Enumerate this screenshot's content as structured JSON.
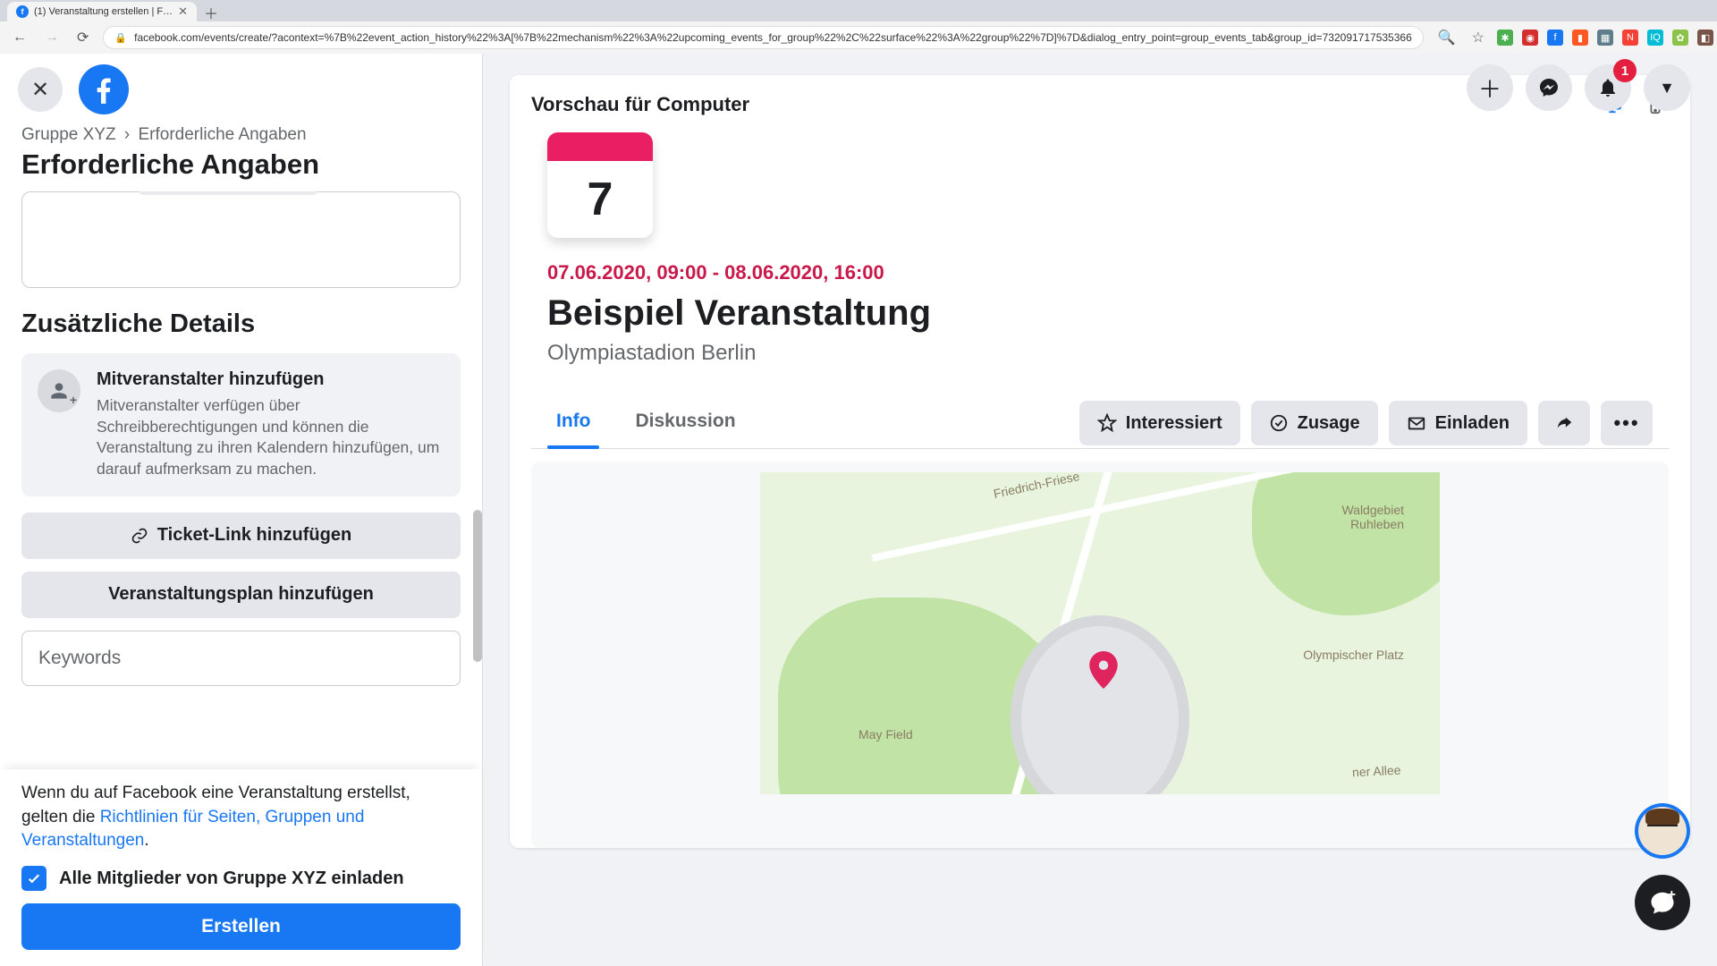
{
  "browser": {
    "tab_title": "(1) Veranstaltung erstellen | F…",
    "url": "facebook.com/events/create/?acontext=%7B%22event_action_history%22%3A[%7B%22mechanism%22%3A%22upcoming_events_for_group%22%2C%22surface%22%3A%22group%22%7D]%7D&dialog_entry_point=group_events_tab&group_id=732091717535366"
  },
  "header": {
    "notifications_count": 1
  },
  "sidebar": {
    "breadcrumb_group": "Gruppe XYZ",
    "breadcrumb_page": "Erforderliche Angaben",
    "title": "Erforderliche Angaben",
    "additional_details_title": "Zusätzliche Details",
    "coorganizers": {
      "title": "Mitveranstalter hinzufügen",
      "body": "Mitveranstalter verfügen über Schreibberechtigungen und können die Veranstaltung zu ihren Kalendern hinzufügen, um darauf aufmerksam zu machen."
    },
    "ticket_btn": "Ticket-Link hinzufügen",
    "schedule_btn": "Veranstaltungsplan hinzufügen",
    "keywords_placeholder": "Keywords",
    "policy_text_pre": "Wenn du auf Facebook eine Veranstaltung erstellst, gelten die ",
    "policy_link": "Richtlinien für Seiten, Gruppen und Veranstaltungen",
    "policy_text_post": ".",
    "invite_checkbox_label": "Alle Mitglieder von Gruppe XYZ einladen",
    "invite_checked": true,
    "create_label": "Erstellen"
  },
  "preview": {
    "header_label": "Vorschau für Computer",
    "calendar_day": "7",
    "date_range": "07.06.2020, 09:00 - 08.06.2020, 16:00",
    "event_title": "Beispiel Veranstaltung",
    "location": "Olympiastadion Berlin",
    "tabs": {
      "info": "Info",
      "discussion": "Diskussion"
    },
    "actions": {
      "interested": "Interessiert",
      "going": "Zusage",
      "invite": "Einladen"
    },
    "map_labels": {
      "may_field": "May Field",
      "waldgebiet": "Waldgebiet Ruhleben",
      "olympischer_platz": "Olympischer Platz",
      "ner_allee": "ner Allee",
      "friedrich": "Friedrich-Friese"
    }
  }
}
